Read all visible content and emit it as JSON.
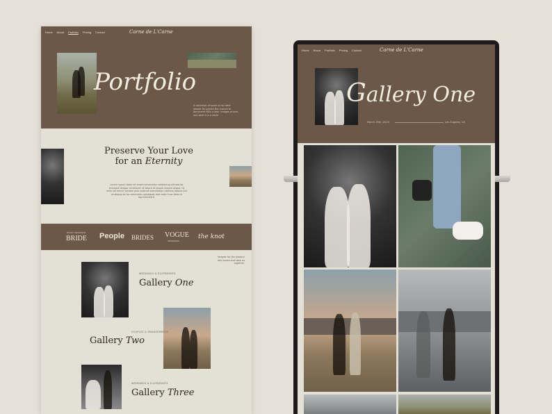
{
  "left": {
    "nav": [
      "Home",
      "About",
      "Portfolio",
      "Pricing",
      "Contact"
    ],
    "logo": "Carne de L'Carne",
    "hero_title": "Portfolio",
    "hero_blurb": "A collection of some of my best people for golden the chance to document stills a look. Images of love and what it is a while",
    "section_title_line1": "Preserve Your Love",
    "section_title_line2": "for an",
    "section_title_script": "Eternity",
    "section_body": "Lorem ipsum dolor sit amet consectetur adipiscing elit sed do eiusmod tempor incididunt ut labore et dolore magna aliqua. Ut enim ad minim veniam quis nostrud exercitation ullamco laboris nisi ut aliquip ex ea commodo consequat duis aute irure dolor in reprehenderit.",
    "press": [
      "BRIDE",
      "People",
      "BRIDES",
      "VOGUE",
      "the knot"
    ],
    "press_sub": [
      "ROCKY MOUNTAIN",
      "",
      "",
      "WEDDINGS",
      ""
    ],
    "side_note": "Images for the modern day lovers and seen as together.",
    "galleries": [
      {
        "label": "WEDDINGS & ELOPEMENTS",
        "word": "Gallery",
        "script": "One"
      },
      {
        "label": "COUPLES & ENGAGEMENTS",
        "word": "Gallery",
        "script": "Two"
      },
      {
        "label": "WEDDINGS & ELOPEMENTS",
        "word": "Gallery",
        "script": "Three"
      }
    ]
  },
  "right": {
    "nav": [
      "Home",
      "About",
      "Portfolio",
      "Pricing",
      "Contact"
    ],
    "logo": "Carne de L'Carne",
    "title_cap": "G",
    "title_rest": "allery One",
    "date": "March 19th, 2023",
    "location": "Los Angeles, CA"
  },
  "colors": {
    "brown": "#6c5848",
    "cream": "#e3e0d5",
    "background": "#e6e1d8"
  }
}
